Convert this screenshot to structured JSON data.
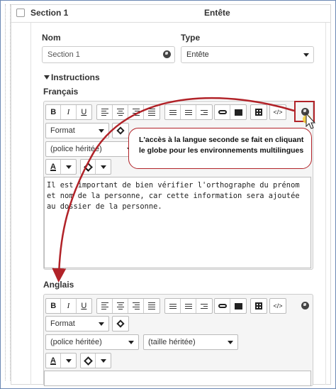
{
  "section": {
    "title": "Section 1",
    "type_label": "Entête"
  },
  "fields": {
    "nom_label": "Nom",
    "nom_value": "Section 1",
    "type_label": "Type",
    "type_value": "Entête"
  },
  "instructions": {
    "toggle_label": "Instructions",
    "french_label": "Français",
    "english_label": "Anglais",
    "french_text": "Il est important de bien vérifier l'orthographe du prénom et nom de la personne, car cette information sera ajoutée au dossier de la personne."
  },
  "toolbar": {
    "bold": "B",
    "italic": "I",
    "underline": "U",
    "format_label": "Format",
    "font_label": "(police héritée)",
    "size_label": "(taille héritée)",
    "code_label": "</>",
    "text_color_label": "A"
  },
  "callout": {
    "text": "L'accès à la langue seconde se fait en cliquant le globe pour les environnements multilingues"
  },
  "colors": {
    "annotation": "#b12228",
    "frame": "#6b87b3"
  },
  "icons": [
    "globe-icon",
    "link-icon",
    "image-icon",
    "table-icon",
    "eraser-icon",
    "cursor-icon",
    "chevron-down-icon"
  ]
}
